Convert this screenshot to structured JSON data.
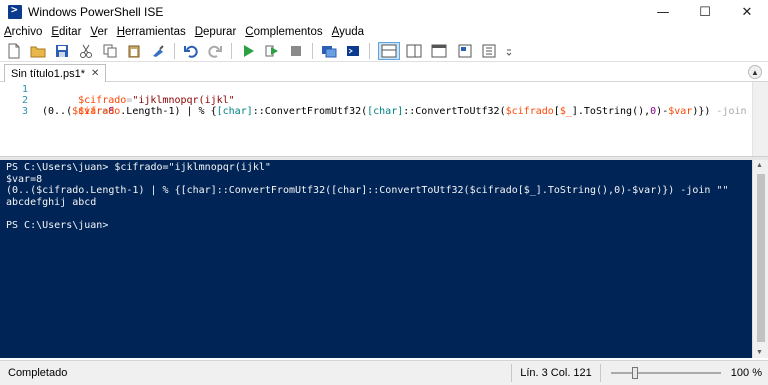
{
  "window": {
    "title": "Windows PowerShell ISE"
  },
  "menu": [
    "Archivo",
    "Editar",
    "Ver",
    "Herramientas",
    "Depurar",
    "Complementos",
    "Ayuda"
  ],
  "tab": {
    "label": "Sin título1.ps1*"
  },
  "editor": {
    "lines": [
      "1",
      "2",
      "3"
    ],
    "line1": {
      "var": "$cifrado",
      "eq": "=",
      "str": "\"ijklmnopqr(ijkl\""
    },
    "line2": {
      "var": "$var",
      "eq": "=",
      "num": "8"
    },
    "line3": {
      "p1": "(0..(",
      "var1": "$cifrado",
      "p2": ".Length-1) | % {",
      "type1": "[char]",
      "p3": "::ConvertFromUtf32(",
      "type2": "[char]",
      "p4": "::ConvertToUtf32(",
      "var2": "$cifrado",
      "p5": "[",
      "var3": "$_",
      "p6": "].ToString(),",
      "num": "0",
      "p7": ")-",
      "var4": "$var",
      "p8": ")}) ",
      "param": "-join",
      "str": " \"\""
    }
  },
  "console": {
    "lines": [
      "PS C:\\Users\\juan> $cifrado=\"ijklmnopqr(ijkl\"",
      "$var=8",
      "(0..($cifrado.Length-1) | % {[char]::ConvertFromUtf32([char]::ConvertToUtf32($cifrado[$_].ToString(),0)-$var)}) -join \"\"",
      "abcdefghij abcd",
      "",
      "PS C:\\Users\\juan>"
    ]
  },
  "status": {
    "text": "Completado",
    "position": "Lín. 3  Col. 121",
    "zoom": "100 %",
    "zoom_fraction": 0.2
  },
  "colors": {
    "console_bg": "#012456",
    "accent": "#0b3b8f"
  }
}
